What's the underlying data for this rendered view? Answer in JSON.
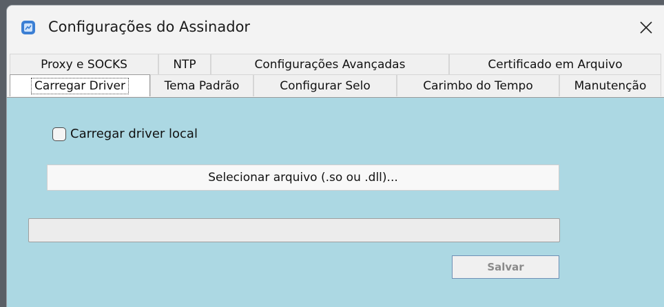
{
  "window": {
    "title": "Configurações do Assinador",
    "icon": "app-icon",
    "close_icon": "close-icon"
  },
  "tabs": {
    "row1": [
      {
        "label": "Proxy e SOCKS"
      },
      {
        "label": "NTP"
      },
      {
        "label": "Configurações Avançadas"
      },
      {
        "label": "Certificado em Arquivo"
      }
    ],
    "row2": [
      {
        "label": "Carregar Driver",
        "active": true
      },
      {
        "label": "Tema Padrão"
      },
      {
        "label": "Configurar Selo"
      },
      {
        "label": "Carimbo do Tempo"
      },
      {
        "label": "Manutenção"
      }
    ]
  },
  "panel": {
    "checkbox_label": "Carregar driver local",
    "checkbox_checked": false,
    "select_file_label": "Selecionar arquivo (.so ou .dll)...",
    "path_value": "",
    "save_label": "Salvar",
    "background_color": "#acd8e3"
  }
}
